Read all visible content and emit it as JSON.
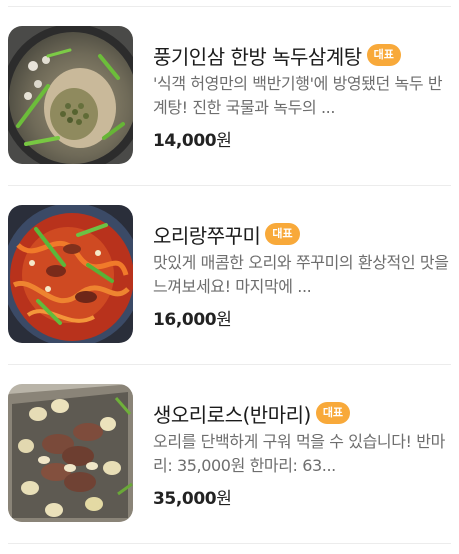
{
  "accent_color": "#f8a93a",
  "menu": {
    "items": [
      {
        "name": "풍기인삼 한방 녹두삼계탕",
        "badge": "대표",
        "description": "'식객 허영만의 백반기행'에 방영됐던 녹두 반계탕! 진한 국물과 녹두의 ...",
        "price_value": "14,000",
        "price_unit": "원",
        "image": "samgyetang-photo"
      },
      {
        "name": "오리랑쭈꾸미",
        "badge": "대표",
        "description": "맛있게 매콤한 오리와 쭈꾸미의 환상적인 맛을 느껴보세요! 마지막에 ...",
        "price_value": "16,000",
        "price_unit": "원",
        "image": "duck-webfoot-octopus-photo"
      },
      {
        "name": "생오리로스(반마리)",
        "badge": "대표",
        "description": "오리를 단백하게 구워 먹을 수 있습니다! 반마리: 35,000원 한마리: 63...",
        "price_value": "35,000",
        "price_unit": "원",
        "image": "duck-roast-photo"
      }
    ]
  }
}
